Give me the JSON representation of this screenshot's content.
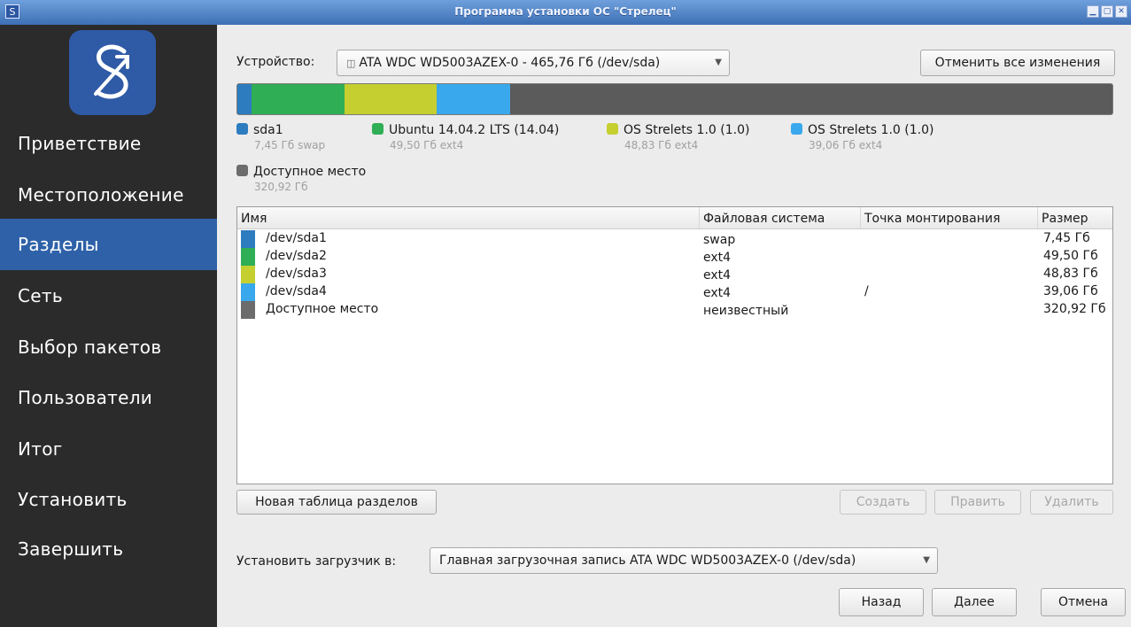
{
  "window": {
    "title": "Программа установки ОС \"Стрелец\"",
    "app_icon": "S",
    "buttons": [
      "▁",
      "▢",
      "✕"
    ]
  },
  "sidebar": {
    "items": [
      {
        "label": "Приветствие",
        "active": false
      },
      {
        "label": "Местоположение",
        "active": false
      },
      {
        "label": "Разделы",
        "active": true
      },
      {
        "label": "Сеть",
        "active": false
      },
      {
        "label": "Выбор пакетов",
        "active": false
      },
      {
        "label": "Пользователи",
        "active": false
      },
      {
        "label": "Итог",
        "active": false
      },
      {
        "label": "Установить",
        "active": false
      },
      {
        "label": "Завершить",
        "active": false
      }
    ]
  },
  "device": {
    "label": "Устройство:",
    "selected": "ATA WDC WD5003AZEX-0 - 465,76 Гб (/dev/sda)",
    "revert_label": "Отменить все изменения"
  },
  "partitions_bar": [
    {
      "color": "#2d7cbf",
      "size": 7.45
    },
    {
      "color": "#2fae55",
      "size": 49.5
    },
    {
      "color": "#c5cf2f",
      "size": 48.83
    },
    {
      "color": "#3aa8ec",
      "size": 39.06
    },
    {
      "color": "#5b5b5b",
      "size": 320.92
    }
  ],
  "legend": [
    {
      "name": "sda1",
      "detail": "7,45 Гб  swap",
      "color": "#2d7cbf"
    },
    {
      "name": "Ubuntu 14.04.2 LTS (14.04)",
      "detail": "49,50 Гб  ext4",
      "color": "#2fae55"
    },
    {
      "name": "OS Strelets 1.0 (1.0)",
      "detail": "48,83 Гб  ext4",
      "color": "#c5cf2f"
    },
    {
      "name": "OS Strelets 1.0 (1.0)",
      "detail": "39,06 Гб  ext4",
      "color": "#3aa8ec"
    },
    {
      "name": "Доступное место",
      "detail": "320,92 Гб",
      "color": "#6c6c6c"
    }
  ],
  "table": {
    "headers": [
      "Имя",
      "Файловая система",
      "Точка монтирования",
      "Размер"
    ],
    "rows": [
      {
        "name": "/dev/sda1",
        "fs": "swap",
        "mount": "",
        "size": "7,45 Гб",
        "color": "#2d7cbf"
      },
      {
        "name": "/dev/sda2",
        "fs": "ext4",
        "mount": "",
        "size": "49,50 Гб",
        "color": "#2fae55"
      },
      {
        "name": "/dev/sda3",
        "fs": "ext4",
        "mount": "",
        "size": "48,83 Гб",
        "color": "#c5cf2f"
      },
      {
        "name": "/dev/sda4",
        "fs": "ext4",
        "mount": "/",
        "size": "39,06 Гб",
        "color": "#3aa8ec"
      },
      {
        "name": "Доступное место",
        "fs": "неизвестный",
        "mount": "",
        "size": "320,92 Гб",
        "color": "#6c6c6c"
      }
    ]
  },
  "actions": {
    "new_table": "Новая таблица разделов",
    "create": "Создать",
    "edit": "Править",
    "delete": "Удалить"
  },
  "bootloader": {
    "label": "Установить загрузчик в:",
    "selected": "Главная загрузочная запись ATA WDC WD5003AZEX-0 (/dev/sda)"
  },
  "nav": {
    "back": "Назад",
    "next": "Далее",
    "cancel": "Отмена"
  }
}
